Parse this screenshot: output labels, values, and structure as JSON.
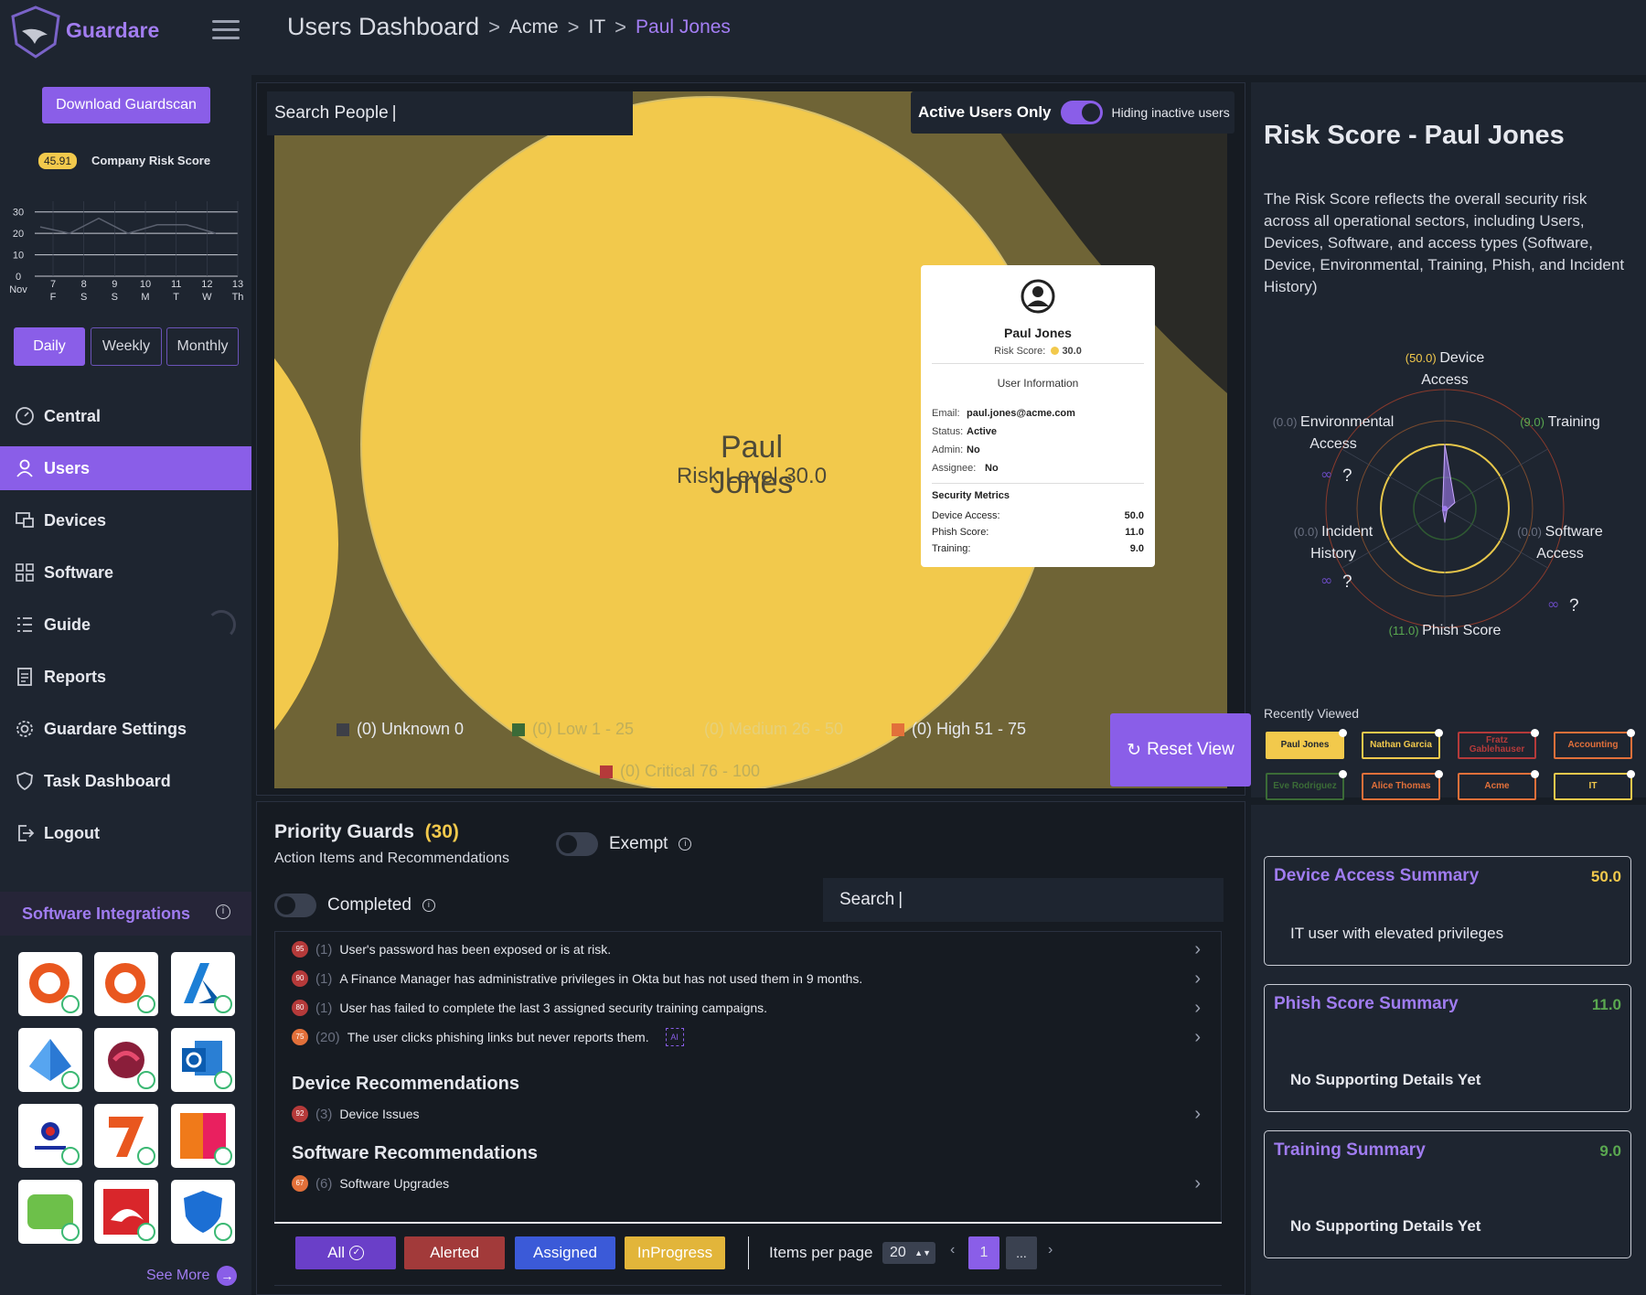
{
  "app": {
    "brand": "Guardare"
  },
  "breadcrumb": {
    "root": "Users Dashboard",
    "org": "Acme",
    "dept": "IT",
    "current": "Paul Jones"
  },
  "sidebar": {
    "download_label": "Download Guardscan",
    "company_risk_value": "45.91",
    "company_risk_label": "Company Risk Score",
    "spark": {
      "y_ticks": [
        "30",
        "20",
        "10",
        "0"
      ],
      "x_ticks": [
        {
          "d": "",
          "w": "Nov"
        },
        {
          "d": "7",
          "w": "F"
        },
        {
          "d": "8",
          "w": "S"
        },
        {
          "d": "9",
          "w": "S"
        },
        {
          "d": "10",
          "w": "M"
        },
        {
          "d": "11",
          "w": "T"
        },
        {
          "d": "12",
          "w": "W"
        },
        {
          "d": "13",
          "w": "Th"
        }
      ],
      "values": [
        23,
        20,
        27,
        20,
        24,
        24,
        20
      ],
      "ylim": [
        0,
        35
      ]
    },
    "periods": [
      "Daily",
      "Weekly",
      "Monthly"
    ],
    "nav": [
      "Central",
      "Users",
      "Devices",
      "Software",
      "Guide",
      "Reports",
      "Guardare Settings",
      "Task Dashboard",
      "Logout"
    ],
    "integrations_title": "Software Integrations",
    "see_more": "See More"
  },
  "bubble": {
    "search_placeholder": "Search People",
    "active_only_label": "Active Users Only",
    "hiding_label": "Hiding inactive users",
    "user_name": "Paul Jones",
    "risk_level": "Risk Level 30.0",
    "reset_label": "Reset View",
    "legend": [
      {
        "label": "(0)  Unknown 0",
        "color": "#3d3f47"
      },
      {
        "label": "(0)  Low 1 - 25",
        "color": "#3b6b37"
      },
      {
        "label": "(0)  Medium 26 - 50",
        "color": "#f2c94c"
      },
      {
        "label": "(0)  High 51 - 75",
        "color": "#e2703a"
      },
      {
        "label": "(0)  Critical 76 - 100",
        "color": "#b53a3a"
      }
    ],
    "popup": {
      "name": "Paul Jones",
      "risk_label": "Risk Score:",
      "risk_value": "30.0",
      "info_title": "User Information",
      "email_label": "Email:",
      "email": "paul.jones@acme.com",
      "status_label": "Status:",
      "status": "Active",
      "admin_label": "Admin:",
      "admin": "No",
      "assignee_label": "Assignee:",
      "assignee": "No",
      "metrics_title": "Security Metrics",
      "metrics": [
        {
          "label": "Device Access:",
          "value": "50.0"
        },
        {
          "label": "Phish Score:",
          "value": "11.0"
        },
        {
          "label": "Training:",
          "value": "9.0"
        }
      ]
    }
  },
  "guards": {
    "title": "Priority Guards",
    "count": "(30)",
    "subtitle": "Action Items and Recommendations",
    "exempt_label": "Exempt",
    "completed_label": "Completed",
    "search_placeholder": "Search",
    "items": [
      {
        "pri": "95",
        "color": "#b53a3a",
        "count": "(1)",
        "text": "User's password has been exposed or is at risk."
      },
      {
        "pri": "90",
        "color": "#b53a3a",
        "count": "(1)",
        "text": "A Finance Manager has administrative privileges in Okta but has not used them in 9 months."
      },
      {
        "pri": "80",
        "color": "#b53a3a",
        "count": "(1)",
        "text": "User has failed to complete the last 3 assigned security training campaigns."
      },
      {
        "pri": "75",
        "color": "#e2703a",
        "count": "(20)",
        "text": "The user clicks phishing links but never reports them."
      }
    ],
    "device_section": "Device Recommendations",
    "device_item": {
      "pri": "92",
      "color": "#b53a3a",
      "count": "(3)",
      "text": "Device Issues"
    },
    "software_section": "Software Recommendations",
    "software_item": {
      "pri": "67",
      "color": "#e2703a",
      "count": "(6)",
      "text": "Software Upgrades"
    },
    "filters": [
      "All",
      "Alerted",
      "Assigned",
      "InProgress"
    ],
    "items_per_page_label": "Items per page",
    "items_per_page": "20",
    "page": "1",
    "ellipsis": "..."
  },
  "risk": {
    "title": "Risk Score - Paul Jones",
    "description": "The Risk Score reflects the overall security risk across all operational sectors, including Users, Devices, Software, and access types (Software, Device, Environmental, Training, Phish, and Incident History)",
    "radar": [
      {
        "value": "(50.0)",
        "name1": "Device",
        "name2": "Access",
        "vcolor": "#f2c94c"
      },
      {
        "value": "(9.0)",
        "name1": "Training",
        "name2": "",
        "vcolor": "#5aa850"
      },
      {
        "value": "(0.0)",
        "name1": "Software",
        "name2": "Access",
        "vcolor": "#6a7080"
      },
      {
        "value": "(11.0)",
        "name1": "Phish Score",
        "name2": "",
        "vcolor": "#5aa850"
      },
      {
        "value": "(0.0)",
        "name1": "Incident",
        "name2": "History",
        "vcolor": "#6a7080"
      },
      {
        "value": "(0.0)",
        "name1": "Environmental",
        "name2": "Access",
        "vcolor": "#6a7080"
      }
    ],
    "radar_values": [
      50,
      9,
      0,
      11,
      0,
      0
    ],
    "unknown_mark": "?",
    "recently_viewed_label": "Recently Viewed",
    "recent": [
      {
        "label": "Paul Jones",
        "color": "#f2c94c"
      },
      {
        "label": "Nathan Garcia",
        "color": "#f2c94c"
      },
      {
        "label": "Fratz Gablehauser",
        "color": "#b53a3a"
      },
      {
        "label": "Accounting",
        "color": "#e2703a"
      },
      {
        "label": "Eve Rodriguez",
        "color": "#3b6b37"
      },
      {
        "label": "Alice Thomas",
        "color": "#e2703a"
      },
      {
        "label": "Acme",
        "color": "#e2703a"
      },
      {
        "label": "IT",
        "color": "#f2c94c"
      }
    ]
  },
  "summaries": [
    {
      "title": "Device Access Summary",
      "value": "50.0",
      "vcolor": "#f2c94c",
      "detail": "IT user with elevated privileges"
    },
    {
      "title": "Phish Score Summary",
      "value": "11.0",
      "vcolor": "#5aa850",
      "detail": "No Supporting Details Yet"
    },
    {
      "title": "Training Summary",
      "value": "9.0",
      "vcolor": "#5aa850",
      "detail": "No Supporting Details Yet"
    }
  ]
}
